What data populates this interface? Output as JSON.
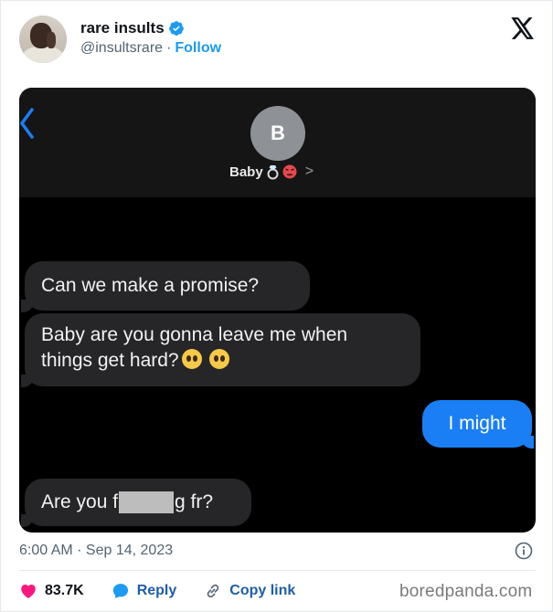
{
  "author": {
    "name": "rare insults",
    "handle": "@insultsrare",
    "separator": "·",
    "follow_label": "Follow"
  },
  "chat": {
    "contact_initial": "B",
    "contact_name": "Baby",
    "contact_chevron": ">",
    "messages": [
      {
        "side": "left",
        "text": "Can we make a promise?"
      },
      {
        "side": "left",
        "line1": "Baby are you gonna leave me when",
        "line2": "things get hard?"
      },
      {
        "side": "right",
        "text": "I might"
      },
      {
        "side": "left",
        "before": "Are you f",
        "after": "g fr?"
      }
    ]
  },
  "tweet": {
    "timestamp": "6:00 AM · Sep 14, 2023",
    "likes": "83.7K",
    "reply_label": "Reply",
    "copy_label": "Copy link"
  },
  "watermark": "boredpanda.com",
  "colors": {
    "accent": "#1d9bf0",
    "like": "#f91880",
    "imessage_blue": "#1a7ff4",
    "bubble_gray": "#262629"
  },
  "icons": [
    "verified-badge-icon",
    "x-logo-icon",
    "back-chevron-icon",
    "ring-emoji-icon",
    "angry-emoji-icon",
    "pleading-emoji-icon",
    "info-icon",
    "heart-icon",
    "reply-bubble-icon",
    "link-icon"
  ]
}
